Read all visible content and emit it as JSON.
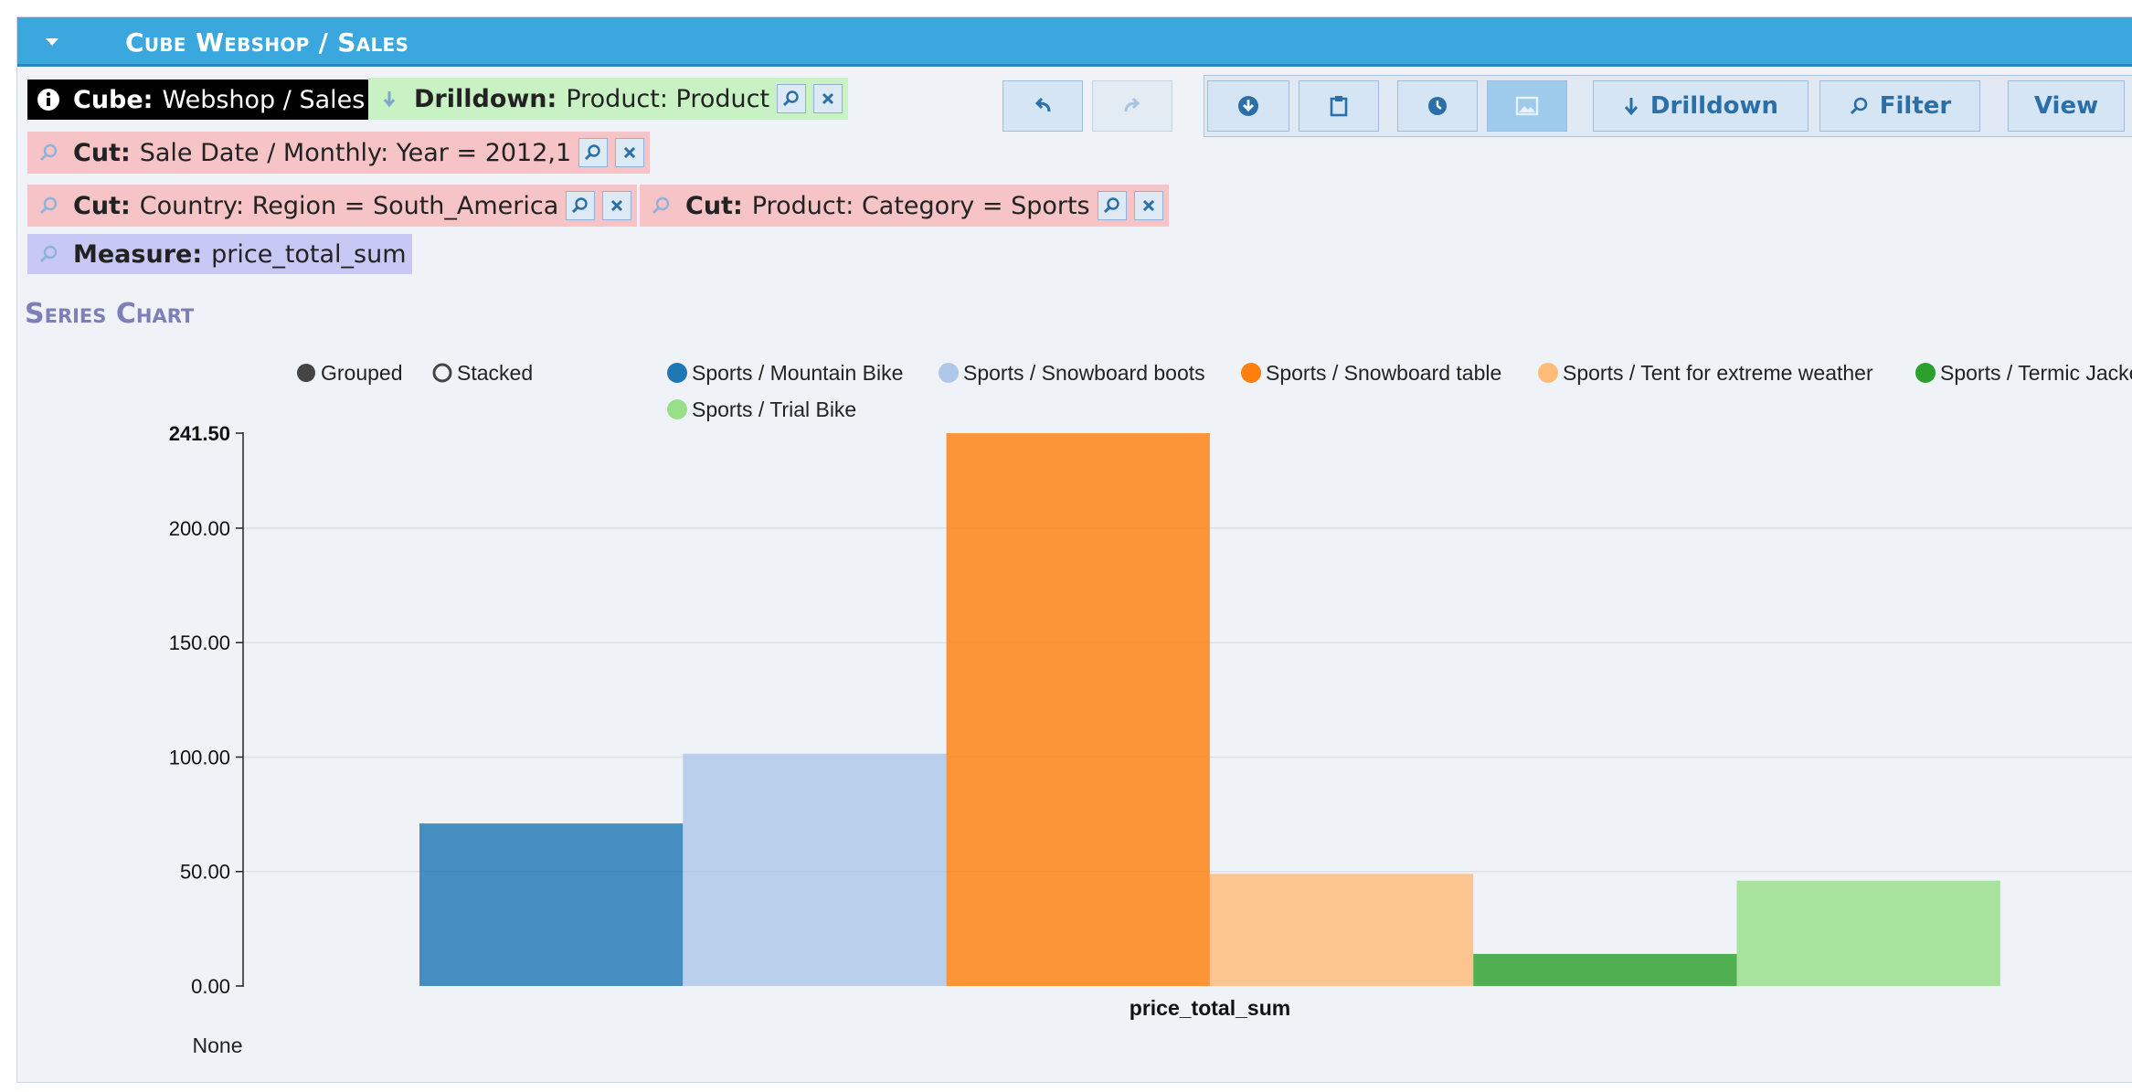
{
  "panel": {
    "title": "Cube Webshop / Sales"
  },
  "chips": {
    "cube": {
      "label": "Cube:",
      "value": "Webshop / Sales"
    },
    "drilldown": {
      "label": "Drilldown:",
      "value": "Product: Product"
    },
    "cut_date": {
      "label": "Cut:",
      "value": "Sale Date / Monthly: Year = 2012,1"
    },
    "cut_region": {
      "label": "Cut:",
      "value": "Country: Region = South_America"
    },
    "cut_category": {
      "label": "Cut:",
      "value": "Product: Category = Sports"
    },
    "measure": {
      "label": "Measure:",
      "value": "price_total_sum"
    }
  },
  "toolbar": {
    "drilldown_label": "Drilldown",
    "filter_label": "Filter",
    "view_label": "View"
  },
  "chart": {
    "heading": "Series Chart",
    "mode_grouped": "Grouped",
    "mode_stacked": "Stacked",
    "selected_mode": "grouped"
  },
  "colors": {
    "titlebar": "#3aa8df",
    "accent": "#2a6fa8"
  },
  "chart_data": {
    "type": "bar",
    "categories": [
      "price_total_sum"
    ],
    "series": [
      {
        "name": "Sports / Mountain Bike",
        "values": [
          71
        ],
        "color": "#1f77b4"
      },
      {
        "name": "Sports / Snowboard boots",
        "values": [
          101.5
        ],
        "color": "#aec7e8"
      },
      {
        "name": "Sports / Snowboard table",
        "values": [
          241.5
        ],
        "color": "#ff7f0e"
      },
      {
        "name": "Sports / Tent for extreme weather",
        "values": [
          49
        ],
        "color": "#ffbb78"
      },
      {
        "name": "Sports / Termic Jacke",
        "values": [
          14
        ],
        "color": "#2ca02c"
      },
      {
        "name": "Sports / Trial Bike",
        "values": [
          46
        ],
        "color": "#98df8a"
      }
    ],
    "yticks": [
      "0.00",
      "50.00",
      "100.00",
      "150.00",
      "200.00",
      "241.50"
    ],
    "ylim": [
      0,
      241.5
    ],
    "xlabel": "price_total_sum",
    "footer_label": "None",
    "grid": true,
    "legend_position": "top"
  }
}
